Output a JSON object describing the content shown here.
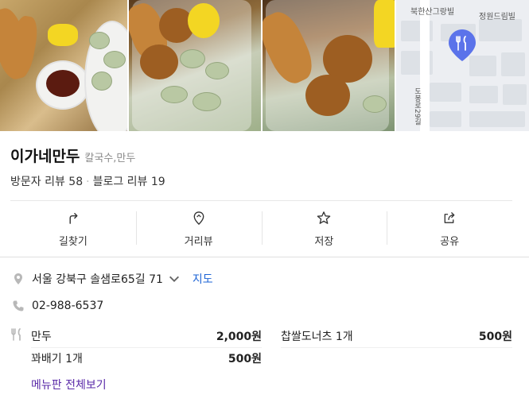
{
  "map": {
    "labels": [
      "북한산그랑빌",
      "정원드림빌",
      "도봉로29길"
    ]
  },
  "place": {
    "name": "이가네만두",
    "category": "칼국수,만두",
    "visitor_reviews": "방문자 리뷰 58",
    "blog_reviews": "블로그 리뷰 19"
  },
  "actions": [
    {
      "label": "길찾기",
      "icon": "directions-icon"
    },
    {
      "label": "거리뷰",
      "icon": "streetview-icon"
    },
    {
      "label": "저장",
      "icon": "star-icon"
    },
    {
      "label": "공유",
      "icon": "share-icon"
    }
  ],
  "info": {
    "address": "서울 강북구 솔샘로65길 71",
    "map_link": "지도",
    "phone": "02-988-6537"
  },
  "menu": {
    "items": [
      {
        "name": "만두",
        "price": "2,000원"
      },
      {
        "name": "찹쌀도너츠 1개",
        "price": "500원"
      },
      {
        "name": "꽈배기 1개",
        "price": "500원"
      }
    ],
    "more_label": "메뉴판 전체보기"
  },
  "colors": {
    "accent_link": "#1e64d6",
    "menu_link": "#5a2aa8",
    "pin": "#5b73ea"
  }
}
